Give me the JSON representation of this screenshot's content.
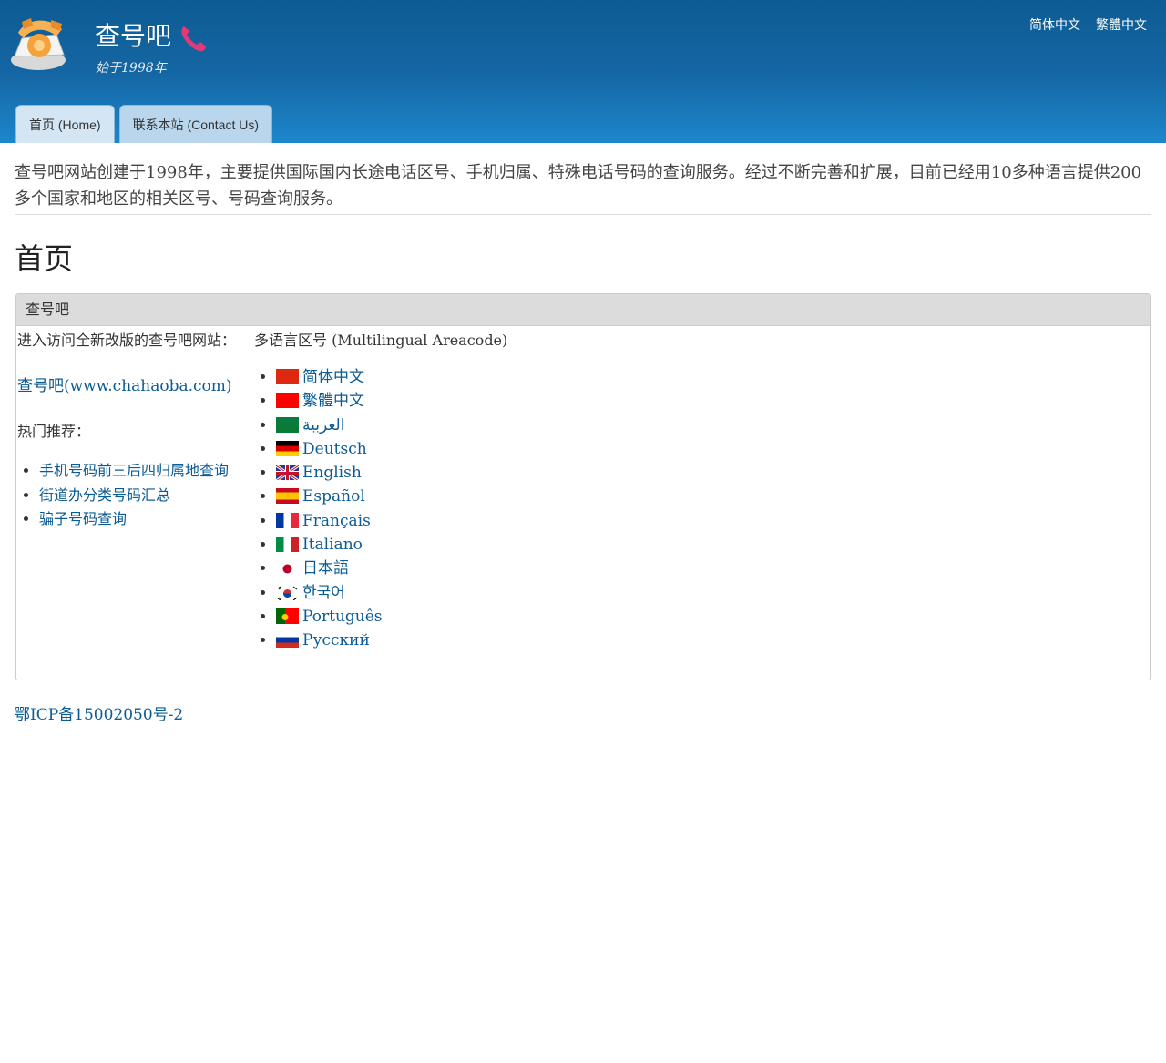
{
  "header": {
    "title": "查号吧",
    "slogan": "始于1998年",
    "lang_links": [
      "简体中文",
      "繁體中文"
    ],
    "tabs": [
      {
        "label": "首页 (Home)",
        "active": true
      },
      {
        "label": "联系本站 (Contact Us)",
        "active": false
      }
    ],
    "icons": {
      "logo": "rotary-phone-logo",
      "title_icon": "phone-handset-icon"
    },
    "colors": {
      "header_top": "#0d5b93",
      "header_bottom": "#1d86cb",
      "link": "#0b5b94"
    }
  },
  "intro": "查号吧网站创建于1998年，主要提供国际国内长途电话区号、手机归属、特殊电话号码的查询服务。经过不断完善和扩展，目前已经用10多种语言提供200多个国家和地区的相关区号、号码查询服务。",
  "page_title": "首页",
  "panel": {
    "heading": "查号吧",
    "enter_text": "进入访问全新改版的查号吧网站：",
    "main_link": "查号吧(www.chahaoba.com)",
    "hot_label": "热门推荐：",
    "hot_links": [
      "手机号码前三后四归属地查询",
      "街道办分类号码汇总",
      "骗子号码查询"
    ],
    "multilingual_label": "多语言区号 (Multilingual Areacode)",
    "languages": [
      {
        "label": "简体中文",
        "flag": "cn"
      },
      {
        "label": "繁體中文",
        "flag": "tw"
      },
      {
        "label": "العربية",
        "flag": "sa"
      },
      {
        "label": "Deutsch",
        "flag": "de"
      },
      {
        "label": "English",
        "flag": "gb"
      },
      {
        "label": "Español",
        "flag": "es"
      },
      {
        "label": "Français",
        "flag": "fr"
      },
      {
        "label": "Italiano",
        "flag": "it"
      },
      {
        "label": "日本語",
        "flag": "jp"
      },
      {
        "label": "한국어",
        "flag": "kr"
      },
      {
        "label": "Português",
        "flag": "pt"
      },
      {
        "label": "Русский",
        "flag": "ru"
      }
    ]
  },
  "footer": {
    "icp": "鄂ICP备15002050号-2"
  }
}
